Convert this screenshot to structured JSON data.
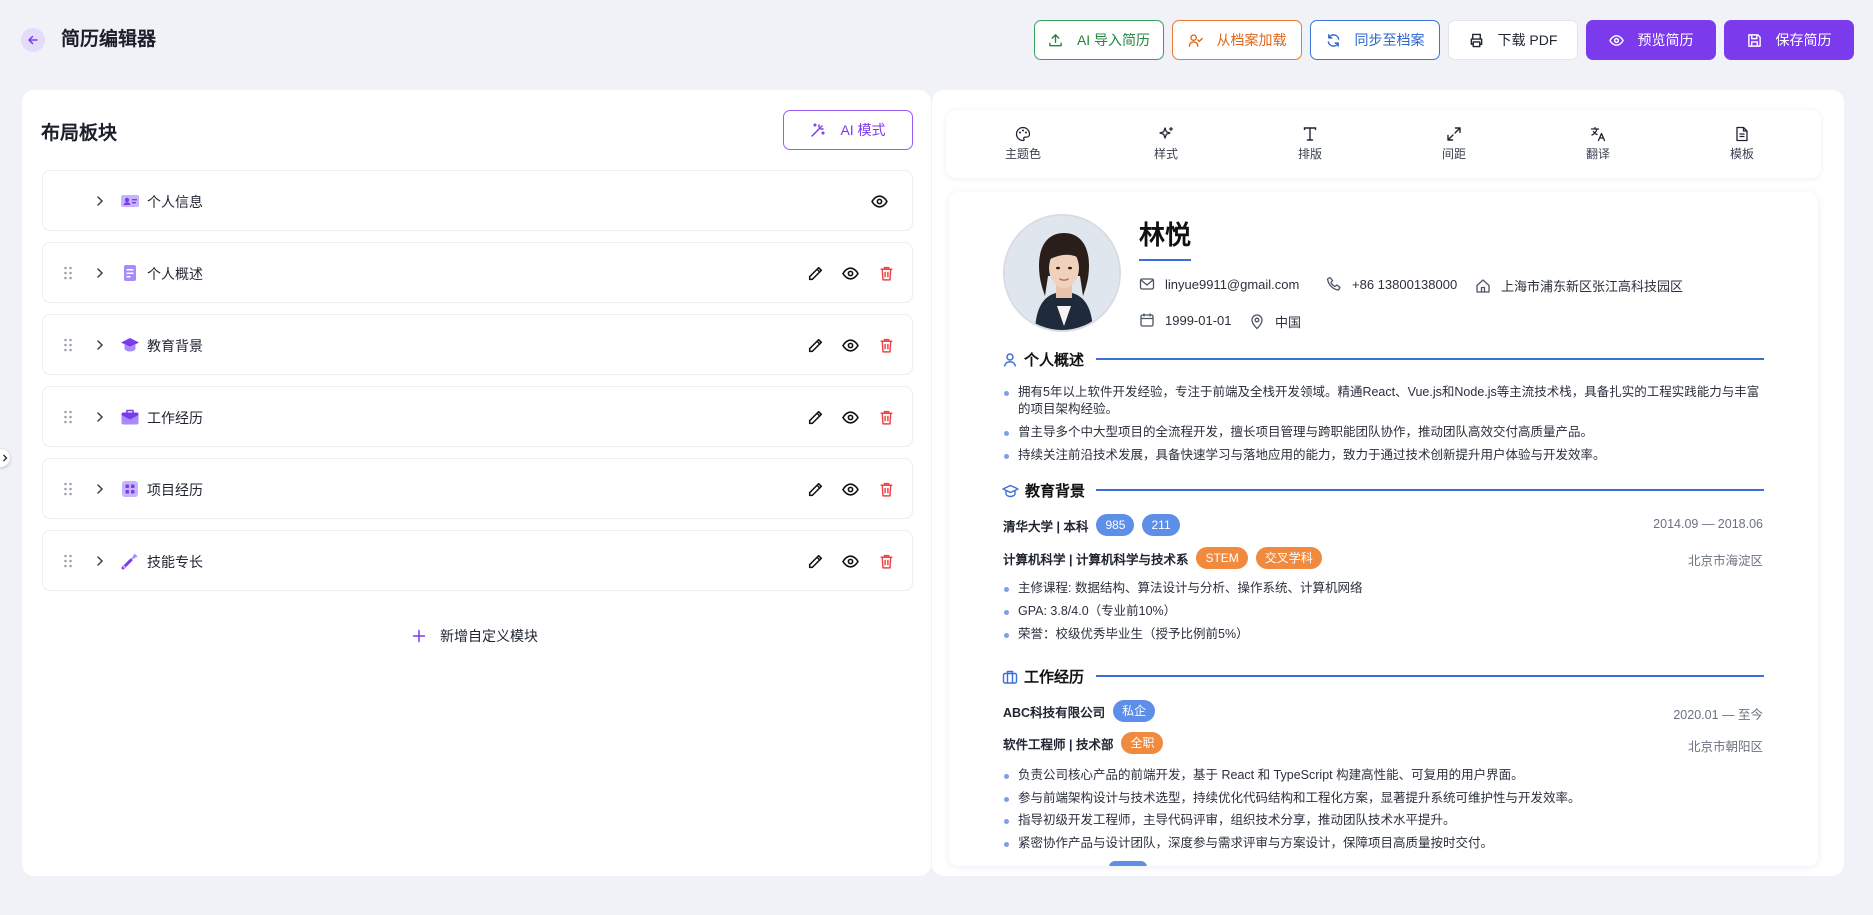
{
  "app": {
    "title": "简历编辑器"
  },
  "toolbar": {
    "ai_import": "AI 导入简历",
    "load_archive": "从档案加载",
    "sync_archive": "同步至档案",
    "download_pdf": "下载 PDF",
    "preview": "预览简历",
    "save": "保存简历"
  },
  "left_panel": {
    "title": "布局板块",
    "ai_mode": "AI 模式",
    "sections": [
      {
        "label": "个人信息",
        "icon": "id-card-icon"
      },
      {
        "label": "个人概述",
        "icon": "document-icon"
      },
      {
        "label": "教育背景",
        "icon": "graduation-cap-icon"
      },
      {
        "label": "工作经历",
        "icon": "briefcase-icon"
      },
      {
        "label": "项目经历",
        "icon": "grid-icon"
      },
      {
        "label": "技能专长",
        "icon": "wrench-icon"
      }
    ],
    "add_custom": "新增自定义模块"
  },
  "tools": [
    {
      "label": "主题色",
      "icon": "palette-icon"
    },
    {
      "label": "样式",
      "icon": "sparkle-icon"
    },
    {
      "label": "排版",
      "icon": "type-icon"
    },
    {
      "label": "间距",
      "icon": "expand-icon"
    },
    {
      "label": "翻译",
      "icon": "translate-icon"
    },
    {
      "label": "模板",
      "icon": "file-icon"
    }
  ],
  "resume": {
    "name": "林悦",
    "email": "linyue9911@gmail.com",
    "phone": "+86 13800138000",
    "address": "上海市浦东新区张江高科技园区",
    "birth": "1999-01-01",
    "location": "中国",
    "summary": {
      "title": "个人概述",
      "items": [
        "拥有5年以上软件开发经验，专注于前端及全栈开发领域。精通React、Vue.js和Node.js等主流技术栈，具备扎实的工程实践能力与丰富的项目架构经验。",
        "曾主导多个中大型项目的全流程开发，擅长项目管理与跨职能团队协作，推动团队高效交付高质量产品。",
        "持续关注前沿技术发展，具备快速学习与落地应用的能力，致力于通过技术创新提升用户体验与开发效率。"
      ]
    },
    "education": {
      "title": "教育背景",
      "school": "清华大学 | 本科",
      "school_tags": [
        "985",
        "211"
      ],
      "period": "2014.09 — 2018.06",
      "major": "计算机科学 | 计算机科学与技术系",
      "major_tags": [
        "STEM",
        "交叉学科"
      ],
      "city": "北京市海淀区",
      "items": [
        "主修课程: 数据结构、算法设计与分析、操作系统、计算机网络",
        "GPA: 3.8/4.0（专业前10%）",
        "荣誉：校级优秀毕业生（授予比例前5%）"
      ]
    },
    "work": {
      "title": "工作经历",
      "company": "ABC科技有限公司",
      "company_tag": "私企",
      "period": "2020.01 — 至今",
      "role": "软件工程师 | 技术部",
      "role_tag": "全职",
      "city": "北京市朝阳区",
      "items": [
        "负责公司核心产品的前端开发，基于 React 和 TypeScript 构建高性能、可复用的用户界面。",
        "参与前端架构设计与技术选型，持续优化代码结构和工程化方案，显著提升系统可维护性与开发效率。",
        "指导初级开发工程师，主导代码评审，组织技术分享，推动团队技术水平提升。",
        "紧密协作产品与设计团队，深度参与需求评审与方案设计，保障项目高质量按时交付。"
      ]
    }
  },
  "colors": {
    "accent": "#7c3aed",
    "resume_blue": "#3b6fd8",
    "tag_blue": "#5e8fe8",
    "tag_orange": "#ef8a3f"
  }
}
